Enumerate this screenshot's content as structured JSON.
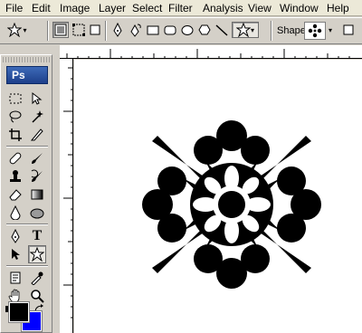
{
  "menu": {
    "items": [
      "File",
      "Edit",
      "Image",
      "Layer",
      "Select",
      "Filter",
      "Analysis",
      "View",
      "Window",
      "Help"
    ]
  },
  "options_bar": {
    "shape_label": "Shape:"
  },
  "toolbox": {
    "logo": "Ps",
    "foreground_color": "#000000",
    "background_color": "#0000ff"
  },
  "canvas": {
    "shape_icon": "flower-ornament",
    "shape_color": "#000000"
  }
}
